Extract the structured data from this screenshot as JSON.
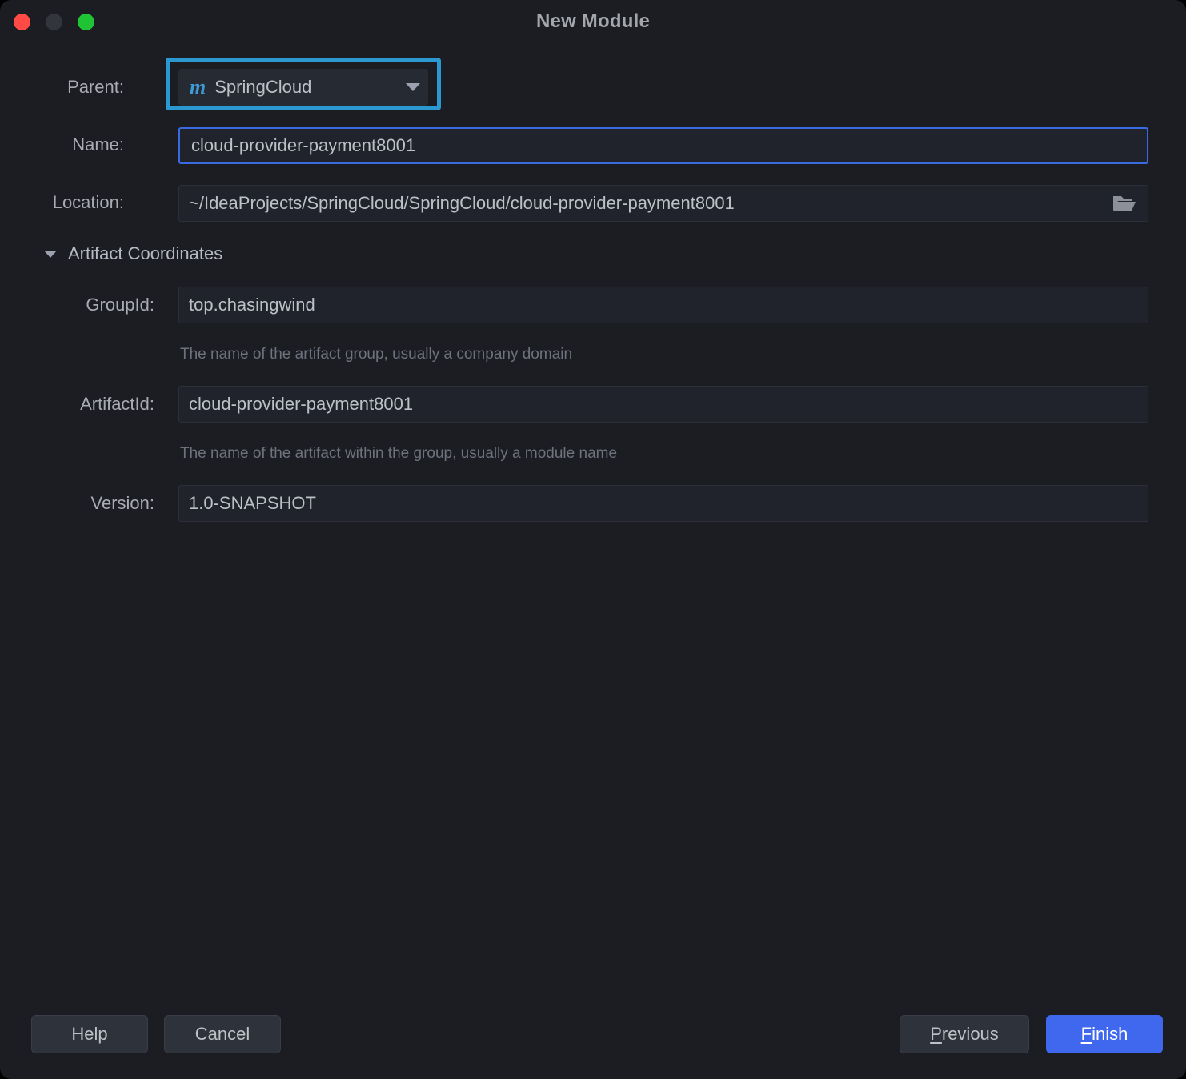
{
  "window": {
    "title": "New Module",
    "traffic_lights": [
      "close-button",
      "minimize-button",
      "maximize-button"
    ],
    "colors": {
      "background": "#1b1d23",
      "field_background": "#20232b",
      "focus_border": "#3a6ae0",
      "highlight_ring": "#2b98d0",
      "primary_button": "#3f68ef",
      "close": "#ff4a45",
      "minimize": "#32353c",
      "maximize": "#1fc333",
      "maven_icon": "#3d9ad4"
    }
  },
  "form": {
    "parent": {
      "label": "Parent:",
      "icon": "maven-m-icon",
      "icon_glyph": "m",
      "value": "SpringCloud",
      "dropdown_icon": "chevron-down-icon"
    },
    "name": {
      "label": "Name:",
      "value": "cloud-provider-payment8001",
      "focused": true
    },
    "location": {
      "label": "Location:",
      "value": "~/IdeaProjects/SpringCloud/SpringCloud/cloud-provider-payment8001",
      "browse_icon": "folder-open-icon"
    }
  },
  "artifact_coordinates": {
    "section_label": "Artifact Coordinates",
    "expander_icon": "triangle-down-icon",
    "expanded": true,
    "group_id": {
      "label": "GroupId:",
      "value": "top.chasingwind",
      "hint": "The name of the artifact group, usually a company domain"
    },
    "artifact_id": {
      "label": "ArtifactId:",
      "value": "cloud-provider-payment8001",
      "hint": "The name of the artifact within the group, usually a module name"
    },
    "version": {
      "label": "Version:",
      "value": "1.0-SNAPSHOT"
    }
  },
  "footer": {
    "help": "Help",
    "cancel": "Cancel",
    "previous": "Previous",
    "previous_mnemonic": "P",
    "previous_rest": "revious",
    "finish": "Finish",
    "finish_mnemonic": "F",
    "finish_rest": "inish"
  }
}
